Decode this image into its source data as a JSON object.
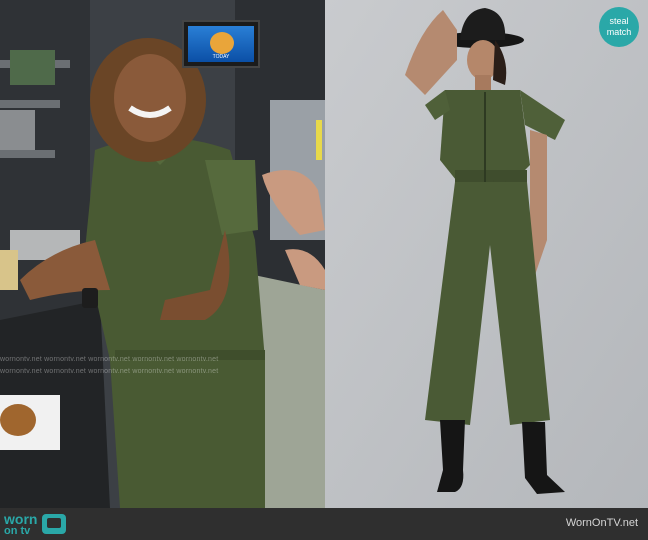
{
  "left_photo": {
    "tv_label": "TODAY",
    "watermark_rows": [
      "wornontv.net wornontv.net wornontv.net wornontv.net wornontv.net",
      "wornontv.net wornontv.net wornontv.net wornontv.net wornontv.net"
    ]
  },
  "badge": {
    "line1": "steal",
    "line2": "match"
  },
  "footer": {
    "logo_top": "worn",
    "logo_bottom": "on tv",
    "site": "WornOnTV.net"
  },
  "colors": {
    "jumpsuit": "#4a5a35",
    "accent": "#2aa8a8",
    "footer_bg": "#2f2f2f"
  }
}
